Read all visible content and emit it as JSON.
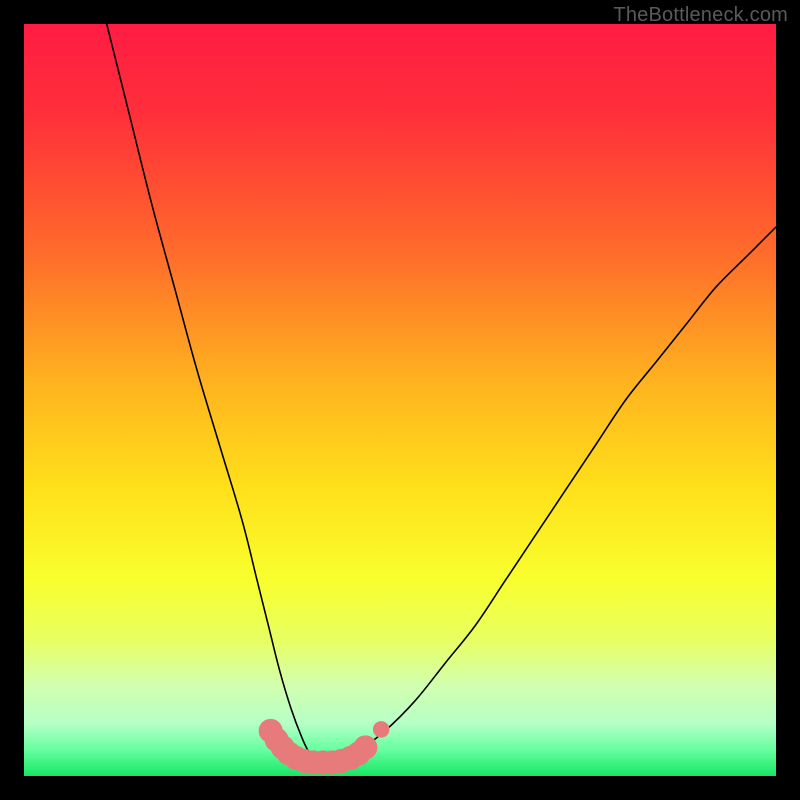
{
  "watermark": "TheBottleneck.com",
  "colors": {
    "frame": "#000000",
    "gradient_stops": [
      {
        "offset": 0.0,
        "color": "#ff1c42"
      },
      {
        "offset": 0.12,
        "color": "#ff2f3a"
      },
      {
        "offset": 0.3,
        "color": "#ff6a2b"
      },
      {
        "offset": 0.48,
        "color": "#ffb41f"
      },
      {
        "offset": 0.62,
        "color": "#ffe11a"
      },
      {
        "offset": 0.74,
        "color": "#f8ff2e"
      },
      {
        "offset": 0.82,
        "color": "#e8ff63"
      },
      {
        "offset": 0.88,
        "color": "#d2ffb0"
      },
      {
        "offset": 0.93,
        "color": "#b6ffc6"
      },
      {
        "offset": 0.965,
        "color": "#66ffa0"
      },
      {
        "offset": 1.0,
        "color": "#16e765"
      }
    ],
    "curve": "#000000",
    "marker_fill": "#e77b7b",
    "marker_stroke": "#d46464"
  },
  "chart_data": {
    "type": "line",
    "title": "",
    "xlabel": "",
    "ylabel": "",
    "xlim": [
      0,
      100
    ],
    "ylim": [
      0,
      100
    ],
    "series": [
      {
        "name": "bottleneck-curve",
        "x": [
          11,
          14,
          17,
          20,
          23,
          26,
          29,
          31,
          32.5,
          34,
          35.5,
          37,
          38,
          39,
          40,
          42,
          44,
          48,
          52,
          56,
          60,
          64,
          68,
          72,
          76,
          80,
          84,
          88,
          92,
          96,
          100
        ],
        "y": [
          100,
          88,
          76,
          65,
          54,
          44,
          34,
          26,
          20,
          14,
          9,
          5,
          3,
          2,
          2,
          2,
          3,
          6,
          10,
          15,
          20,
          26,
          32,
          38,
          44,
          50,
          55,
          60,
          65,
          69,
          73
        ]
      }
    ],
    "markers": {
      "name": "highlighted-range",
      "points": [
        {
          "x": 32.8,
          "y": 6.0,
          "r": 1.6
        },
        {
          "x": 33.6,
          "y": 4.8,
          "r": 1.6
        },
        {
          "x": 34.4,
          "y": 3.8,
          "r": 1.6
        },
        {
          "x": 35.2,
          "y": 3.0,
          "r": 1.6
        },
        {
          "x": 36.2,
          "y": 2.4,
          "r": 1.6
        },
        {
          "x": 37.3,
          "y": 2.0,
          "r": 1.6
        },
        {
          "x": 38.5,
          "y": 1.8,
          "r": 1.6
        },
        {
          "x": 39.8,
          "y": 1.8,
          "r": 1.6
        },
        {
          "x": 41.0,
          "y": 1.8,
          "r": 1.6
        },
        {
          "x": 42.2,
          "y": 2.0,
          "r": 1.6
        },
        {
          "x": 43.4,
          "y": 2.4,
          "r": 1.6
        },
        {
          "x": 44.5,
          "y": 3.0,
          "r": 1.6
        },
        {
          "x": 45.4,
          "y": 3.8,
          "r": 1.6
        },
        {
          "x": 47.5,
          "y": 6.2,
          "r": 1.1
        }
      ]
    }
  }
}
